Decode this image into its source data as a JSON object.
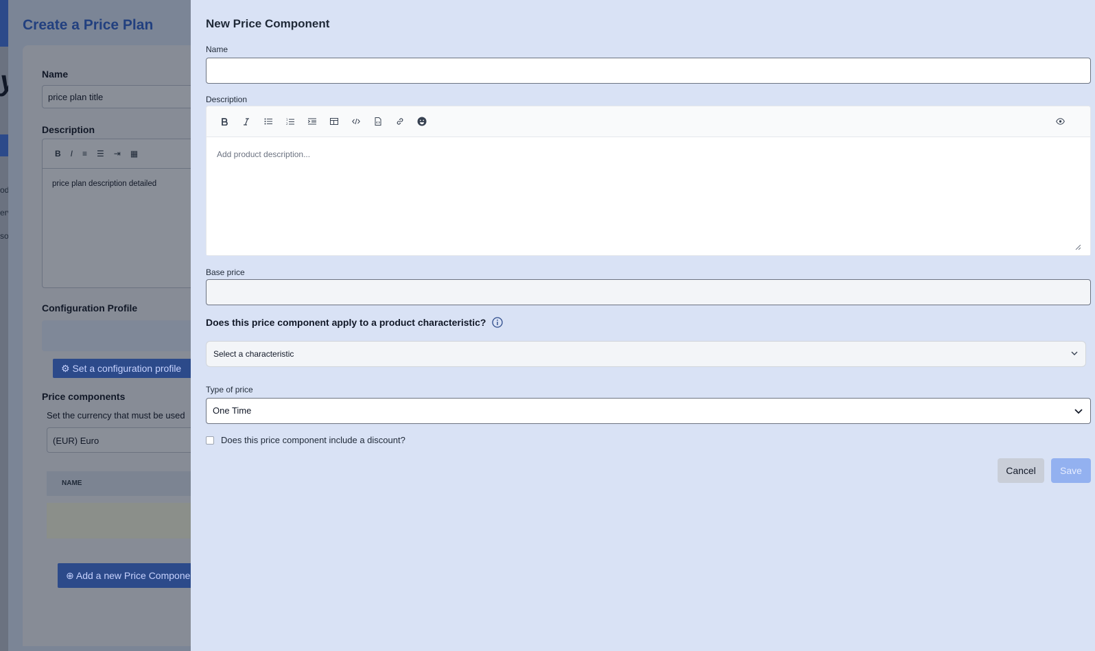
{
  "background": {
    "sidebar_partial": [
      "od",
      "erv",
      "so"
    ],
    "logo_partial": "y",
    "page_title": "Create a Price Plan",
    "name_label": "Name",
    "name_value": "price plan title",
    "description_label": "Description",
    "description_value": "price plan description detailed",
    "config_profile_label": "Configuration Profile",
    "set_config_button": "Set a configuration profile",
    "price_components_label": "Price components",
    "currency_hint": "Set the currency that must be used",
    "currency_value": "(EUR) Euro",
    "table_header_name": "NAME",
    "add_component_button": "Add a new Price Componen"
  },
  "panel": {
    "title": "New Price Component",
    "name_label": "Name",
    "name_value": "",
    "description_label": "Description",
    "description_placeholder": "Add product description...",
    "toolbar_icons": [
      "bold-icon",
      "italic-icon",
      "bullet-list-icon",
      "numbered-list-icon",
      "indent-icon",
      "table-icon",
      "code-icon",
      "code-block-icon",
      "link-icon",
      "emoji-icon",
      "preview-eye-icon"
    ],
    "base_price_label": "Base price",
    "base_price_value": "",
    "characteristic_question": "Does this price component apply to a product characteristic?",
    "characteristic_placeholder": "Select a characteristic",
    "type_of_price_label": "Type of price",
    "type_of_price_value": "One Time",
    "discount_question": "Does this price component include a discount?",
    "cancel_label": "Cancel",
    "save_label": "Save"
  },
  "colors": {
    "panel_bg": "#d9e2f5",
    "primary": "#2c4a8a",
    "save_disabled": "#93b1f0",
    "overlay": "#7b8596"
  }
}
